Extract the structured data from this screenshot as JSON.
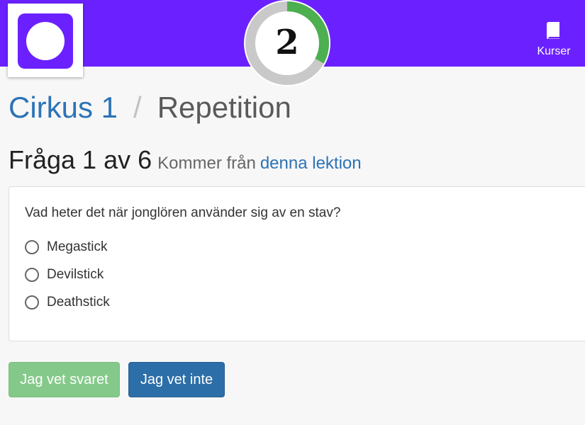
{
  "header": {
    "progress": {
      "value": "2",
      "fraction_complete": 0.33
    },
    "courses": {
      "label": "Kurser",
      "icon": "book-icon"
    }
  },
  "colors": {
    "brand": "#6b21ff",
    "progress_done": "#4caf50",
    "progress_track": "#c9c9c9",
    "link": "#2d73b6"
  },
  "breadcrumb": {
    "course": "Cirkus 1",
    "separator": "/",
    "current": "Repetition"
  },
  "question": {
    "counter": "Fråga 1 av 6",
    "source_prefix": "Kommer från",
    "source_link": "denna lektion",
    "text": "Vad heter det när jonglören använder sig av en stav?",
    "options": [
      "Megastick",
      "Devilstick",
      "Deathstick"
    ]
  },
  "actions": {
    "know": "Jag vet svaret",
    "dont_know": "Jag vet inte"
  }
}
